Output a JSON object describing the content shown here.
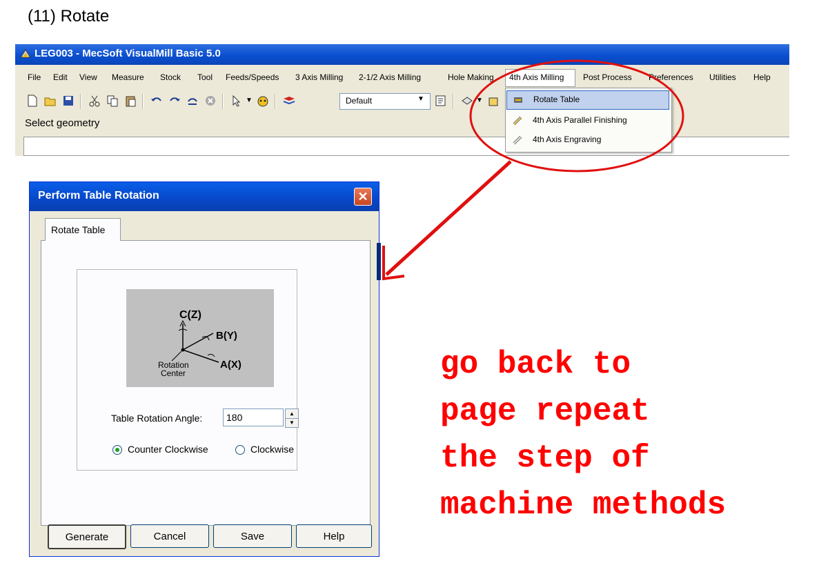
{
  "heading": "(11) Rotate",
  "app": {
    "title": "LEG003 - MecSoft  VisualMill Basic 5.0",
    "menus": [
      "File",
      "Edit",
      "View",
      "Measure",
      "Stock",
      "Tool",
      "Feeds/Speeds",
      "3 Axis Milling",
      "2-1/2 Axis Milling",
      "Hole Making",
      "4th Axis Milling",
      "Post Process",
      "Preferences",
      "Utilities",
      "Help"
    ],
    "combo_value": "Default",
    "status": "Select geometry"
  },
  "dropdown": {
    "items": [
      "Rotate Table",
      "4th Axis Parallel Finishing",
      "4th Axis Engraving"
    ]
  },
  "dialog": {
    "title": "Perform Table Rotation",
    "tab": "Rotate Table",
    "diagram": {
      "c_label": "C(Z)",
      "b_label": "B(Y)",
      "a_label": "A(X)",
      "center_line1": "Rotation",
      "center_line2": "Center"
    },
    "angle_label": "Table Rotation Angle:",
    "angle_value": "180",
    "radio_ccw": "Counter Clockwise",
    "radio_cw": "Clockwise",
    "selected_direction": "Counter Clockwise",
    "buttons": {
      "generate": "Generate",
      "cancel": "Cancel",
      "save": "Save",
      "help": "Help"
    }
  },
  "note": {
    "lines": [
      "go back to",
      "page repeat",
      "the step of",
      "machine methods"
    ],
    "color": "#ff0000"
  },
  "colors": {
    "annotation": "#e01010",
    "titlebar": "#0a4fd0",
    "highlight": "#c1d2ee"
  }
}
